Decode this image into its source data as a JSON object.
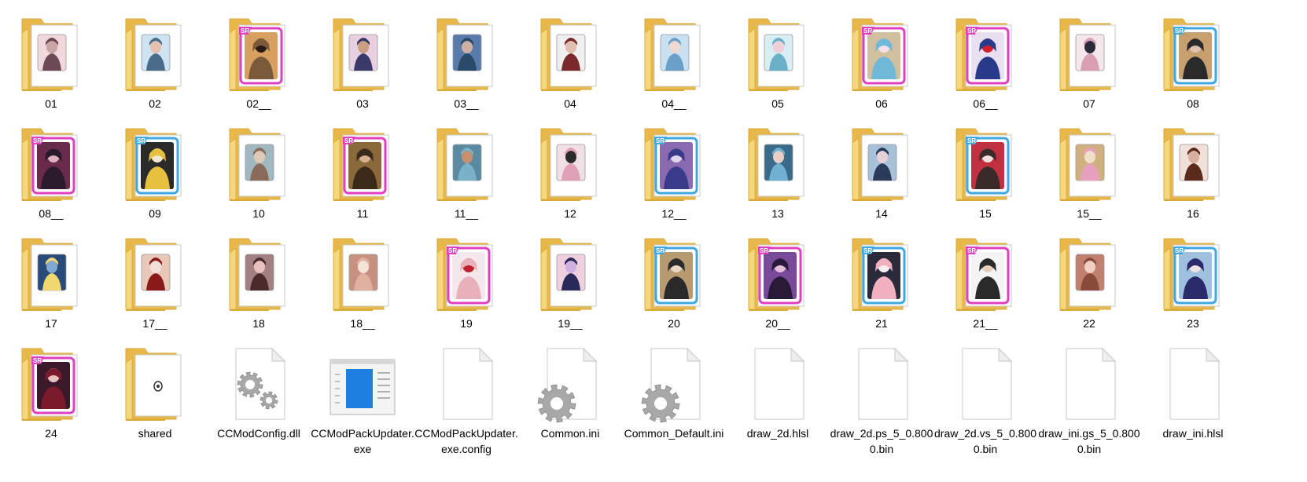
{
  "window": {
    "title": ""
  },
  "items": [
    {
      "label": "01",
      "type": "folder",
      "thumb": "photo",
      "frame": "none",
      "palette": [
        "#6b4a55",
        "#c9a5a8",
        "#f0d8dc"
      ]
    },
    {
      "label": "02",
      "type": "folder",
      "thumb": "photo",
      "frame": "none",
      "palette": [
        "#4a6a8a",
        "#e6c0b0",
        "#cfe4f2"
      ]
    },
    {
      "label": "02__",
      "type": "folder",
      "thumb": "card",
      "frame": "pink",
      "palette": [
        "#7a5a3a",
        "#2a1a18",
        "#d8a060"
      ]
    },
    {
      "label": "03",
      "type": "folder",
      "thumb": "photo",
      "frame": "none",
      "palette": [
        "#3a3a6a",
        "#c8a080",
        "#e8d0e0"
      ]
    },
    {
      "label": "03__",
      "type": "folder",
      "thumb": "photo",
      "frame": "none",
      "palette": [
        "#2a4a6a",
        "#d0b0a0",
        "#5a7aaa"
      ]
    },
    {
      "label": "04",
      "type": "folder",
      "thumb": "photo",
      "frame": "none",
      "palette": [
        "#7a2a2a",
        "#e0c0b0",
        "#f0f0f0"
      ]
    },
    {
      "label": "04__",
      "type": "folder",
      "thumb": "photo",
      "frame": "none",
      "palette": [
        "#6aa0c8",
        "#f0d8d0",
        "#c8e0f0"
      ]
    },
    {
      "label": "05",
      "type": "folder",
      "thumb": "photo",
      "frame": "none",
      "palette": [
        "#6ab0c8",
        "#f0d0d8",
        "#d8eef4"
      ]
    },
    {
      "label": "06",
      "type": "folder",
      "thumb": "card",
      "frame": "pink",
      "palette": [
        "#70b8d8",
        "#f4e0e8",
        "#d0c0a0"
      ]
    },
    {
      "label": "06__",
      "type": "folder",
      "thumb": "card",
      "frame": "pink",
      "palette": [
        "#2a3a8a",
        "#d02030",
        "#e8e0f0"
      ]
    },
    {
      "label": "07",
      "type": "folder",
      "thumb": "photo",
      "frame": "none",
      "palette": [
        "#d8a0b0",
        "#2a2a3a",
        "#f4e8ec"
      ]
    },
    {
      "label": "08",
      "type": "folder",
      "thumb": "card",
      "frame": "blue",
      "palette": [
        "#2a2a2a",
        "#e0c0b0",
        "#c8a070"
      ]
    },
    {
      "label": "08__",
      "type": "folder",
      "thumb": "card",
      "frame": "pink",
      "palette": [
        "#2a1a2a",
        "#e0b0c0",
        "#6a2a4a"
      ]
    },
    {
      "label": "09",
      "type": "folder",
      "thumb": "card",
      "frame": "blue",
      "palette": [
        "#e8c040",
        "#f0e8d0",
        "#2a2a2a"
      ]
    },
    {
      "label": "10",
      "type": "folder",
      "thumb": "photo",
      "frame": "none",
      "palette": [
        "#8a6a5a",
        "#e0c8b8",
        "#a0b8c0"
      ]
    },
    {
      "label": "11",
      "type": "folder",
      "thumb": "card",
      "frame": "pink",
      "palette": [
        "#3a2a1a",
        "#d8b090",
        "#8a6a3a"
      ]
    },
    {
      "label": "11__",
      "type": "folder",
      "thumb": "photo",
      "frame": "none",
      "palette": [
        "#7ab0c8",
        "#c89070",
        "#5a8aa0"
      ]
    },
    {
      "label": "12",
      "type": "folder",
      "thumb": "photo",
      "frame": "none",
      "palette": [
        "#e0a0b8",
        "#2a2a2a",
        "#f0e0e4"
      ]
    },
    {
      "label": "12__",
      "type": "folder",
      "thumb": "card",
      "frame": "blue",
      "palette": [
        "#3a3a8a",
        "#e0d8f0",
        "#8a6ab0"
      ]
    },
    {
      "label": "13",
      "type": "folder",
      "thumb": "photo",
      "frame": "none",
      "palette": [
        "#70b0d0",
        "#e8d0c8",
        "#3a6a8a"
      ]
    },
    {
      "label": "14",
      "type": "folder",
      "thumb": "photo",
      "frame": "none",
      "palette": [
        "#2a3a5a",
        "#e8d0d8",
        "#a8c0d8"
      ]
    },
    {
      "label": "15",
      "type": "folder",
      "thumb": "card",
      "frame": "blue",
      "palette": [
        "#3a2a2a",
        "#f0e0e0",
        "#c03040"
      ]
    },
    {
      "label": "15__",
      "type": "folder",
      "thumb": "photo",
      "frame": "none",
      "palette": [
        "#e8a0c0",
        "#f0e0c8",
        "#d0b080"
      ]
    },
    {
      "label": "16",
      "type": "folder",
      "thumb": "photo",
      "frame": "none",
      "palette": [
        "#5a2a1a",
        "#d8b0a0",
        "#f0e0d8"
      ]
    },
    {
      "label": "17",
      "type": "folder",
      "thumb": "photo",
      "frame": "none",
      "palette": [
        "#f0d870",
        "#80a8d0",
        "#2a4a7a"
      ]
    },
    {
      "label": "17__",
      "type": "folder",
      "thumb": "photo",
      "frame": "none",
      "palette": [
        "#8a1a1a",
        "#f0e0d8",
        "#e8c8b8"
      ]
    },
    {
      "label": "18",
      "type": "folder",
      "thumb": "photo",
      "frame": "none",
      "palette": [
        "#4a2a2a",
        "#e8c0c0",
        "#a08080"
      ]
    },
    {
      "label": "18__",
      "type": "folder",
      "thumb": "photo",
      "frame": "none",
      "palette": [
        "#e0b0a0",
        "#f4e4d8",
        "#c89080"
      ]
    },
    {
      "label": "19",
      "type": "folder",
      "thumb": "card",
      "frame": "pink",
      "palette": [
        "#e8b0b8",
        "#c02030",
        "#f4e8ec"
      ]
    },
    {
      "label": "19__",
      "type": "folder",
      "thumb": "photo",
      "frame": "none",
      "palette": [
        "#2a2a5a",
        "#d0b0e0",
        "#f0d0e0"
      ]
    },
    {
      "label": "20",
      "type": "folder",
      "thumb": "card",
      "frame": "blue",
      "palette": [
        "#2a2a2a",
        "#e8d8c8",
        "#b89a70"
      ]
    },
    {
      "label": "20__",
      "type": "folder",
      "thumb": "card",
      "frame": "pink",
      "palette": [
        "#2a1a3a",
        "#e0c0d8",
        "#7a4a9a"
      ]
    },
    {
      "label": "21",
      "type": "folder",
      "thumb": "card",
      "frame": "blue",
      "palette": [
        "#f0b0c0",
        "#f4f0f0",
        "#2a2a3a"
      ]
    },
    {
      "label": "21__",
      "type": "folder",
      "thumb": "card",
      "frame": "pink",
      "palette": [
        "#2a2a2a",
        "#e8d0c0",
        "#f4f4f4"
      ]
    },
    {
      "label": "22",
      "type": "folder",
      "thumb": "photo",
      "frame": "none",
      "palette": [
        "#8a4a3a",
        "#f0d0c0",
        "#c08070"
      ]
    },
    {
      "label": "23",
      "type": "folder",
      "thumb": "card",
      "frame": "blue",
      "palette": [
        "#2a2a6a",
        "#f0e0e0",
        "#a0c0e0"
      ]
    },
    {
      "label": "24",
      "type": "folder",
      "thumb": "card",
      "frame": "pink",
      "palette": [
        "#7a1a2a",
        "#e8c0c0",
        "#3a1a2a"
      ]
    },
    {
      "label": "shared",
      "type": "folder",
      "thumb": "disc",
      "frame": "none",
      "palette": [
        "#ffffff",
        "#333333",
        "#cccccc"
      ]
    },
    {
      "label": "CCModConfig.dll",
      "type": "dll",
      "thumb": "",
      "frame": "none",
      "palette": []
    },
    {
      "label": "CCModPackUpdater.exe",
      "type": "exe",
      "thumb": "",
      "frame": "none",
      "palette": []
    },
    {
      "label": "CCModPackUpdater.exe.config",
      "type": "blank",
      "thumb": "",
      "frame": "none",
      "palette": []
    },
    {
      "label": "Common.ini",
      "type": "ini",
      "thumb": "",
      "frame": "none",
      "palette": []
    },
    {
      "label": "Common_Default.ini",
      "type": "ini",
      "thumb": "",
      "frame": "none",
      "palette": []
    },
    {
      "label": "draw_2d.hlsl",
      "type": "blank",
      "thumb": "",
      "frame": "none",
      "palette": []
    },
    {
      "label": "draw_2d.ps_5_0.8000.bin",
      "type": "blank",
      "thumb": "",
      "frame": "none",
      "palette": []
    },
    {
      "label": "draw_2d.vs_5_0.8000.bin",
      "type": "blank",
      "thumb": "",
      "frame": "none",
      "palette": []
    },
    {
      "label": "draw_ini.gs_5_0.8000.bin",
      "type": "blank",
      "thumb": "",
      "frame": "none",
      "palette": []
    },
    {
      "label": "draw_ini.hlsl",
      "type": "blank",
      "thumb": "",
      "frame": "none",
      "palette": []
    }
  ],
  "colors": {
    "folder_back": "#e8b94a",
    "folder_front": "#f6d77e",
    "folder_edge": "#d9a93a",
    "paper": "#ffffff",
    "paper_edge": "#c8c8c8",
    "frame_pink": "#e040c0",
    "frame_blue": "#40a8e0",
    "gear": "#a8a8a8",
    "exe_blue": "#1e7fe0"
  }
}
